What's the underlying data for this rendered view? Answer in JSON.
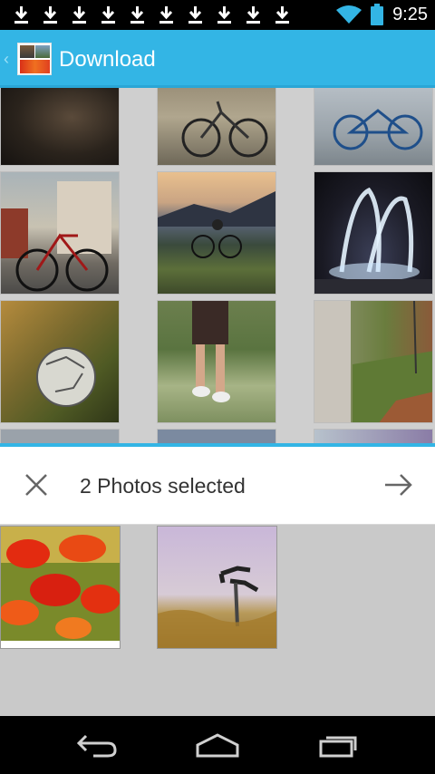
{
  "status_bar": {
    "time": "9:25",
    "notification_icons": [
      "download-icon",
      "download-icon",
      "download-icon",
      "download-icon",
      "download-icon",
      "download-icon",
      "download-icon",
      "download-icon",
      "download-icon",
      "download-icon"
    ],
    "wifi_icon": "wifi-icon",
    "battery_icon": "battery-icon"
  },
  "action_bar": {
    "title": "Download",
    "up_icon": "up-caret-icon",
    "app_icon": "gallery-thumbnail-icon",
    "color": "#33b5e5"
  },
  "grid": {
    "photos": [
      {
        "name": "photo-dark-portrait"
      },
      {
        "name": "photo-bicycles-wall"
      },
      {
        "name": "photo-blue-bicycle"
      },
      {
        "name": "photo-bicycle-street"
      },
      {
        "name": "photo-cyclist-sunset"
      },
      {
        "name": "photo-fountain-night"
      },
      {
        "name": "photo-soccer-ball"
      },
      {
        "name": "photo-runner-legs"
      },
      {
        "name": "photo-swing-park"
      },
      {
        "name": "photo-partial-1"
      },
      {
        "name": "photo-partial-2"
      },
      {
        "name": "photo-partial-3"
      }
    ]
  },
  "selection": {
    "title": "2 Photos selected",
    "close_icon": "close-icon",
    "next_icon": "arrow-right-icon",
    "accent": "#33b5e5"
  },
  "tray": {
    "selected": [
      {
        "name": "selected-photo-poppies"
      },
      {
        "name": "selected-photo-bike-handlebar"
      }
    ]
  },
  "nav_bar": {
    "back_icon": "back-icon",
    "home_icon": "home-icon",
    "recents_icon": "recents-icon"
  }
}
